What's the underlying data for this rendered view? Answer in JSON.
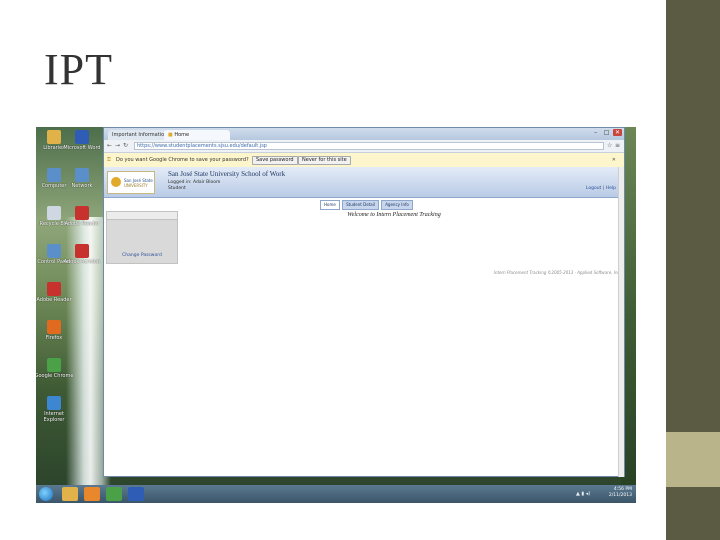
{
  "slide": {
    "title": "IPT"
  },
  "desktop": {
    "icons": [
      {
        "label": "Libraries",
        "icon": "folder-icon",
        "color": "#e2b24a"
      },
      {
        "label": "Microsoft Word",
        "icon": "word-icon",
        "color": "#2f5db5"
      },
      {
        "label": "Computer",
        "icon": "computer-icon",
        "color": "#5b8fc9"
      },
      {
        "label": "Network",
        "icon": "network-icon",
        "color": "#5b8fc9"
      },
      {
        "label": "Recycle Bin",
        "icon": "recycle-bin-icon",
        "color": "#cfd8e2"
      },
      {
        "label": "Adobe Reader",
        "icon": "pdf-icon",
        "color": "#c7322f"
      },
      {
        "label": "Control Panel",
        "icon": "control-panel-icon",
        "color": "#5b8fc9"
      },
      {
        "label": "Adobe Acrobat",
        "icon": "pdf-icon",
        "color": "#c7322f"
      },
      {
        "label": "Adobe Reader",
        "icon": "pdf-icon",
        "color": "#c7322f"
      },
      {
        "label": "Firefox",
        "icon": "firefox-icon",
        "color": "#e06a1f"
      },
      {
        "label": "Google Chrome",
        "icon": "chrome-icon",
        "color": "#4aa148"
      },
      {
        "label": "Internet Explorer",
        "icon": "ie-icon",
        "color": "#3d86d1"
      }
    ]
  },
  "browser": {
    "tabs": [
      {
        "label": "Important Informatio",
        "active": false
      },
      {
        "label": "Home",
        "active": true
      }
    ],
    "window_buttons": {
      "minimize": "–",
      "maximize": "□",
      "close": "✕"
    },
    "nav": {
      "back": "←",
      "forward": "→",
      "reload": "↻",
      "star": "☆",
      "wrench": "≡"
    },
    "url": "https://www.studentplacements.sjsu.edu/default.jsp",
    "infobar": {
      "question": "Do you want Google Chrome to save your password?",
      "save_label": "Save password",
      "never_label": "Never for this site",
      "close": "✕"
    }
  },
  "site": {
    "logo_line1": "San José State",
    "logo_line2": "UNIVERSITY",
    "title": "San José State University School of Work",
    "logged_in": "Logged in: Adair Bloom",
    "role": "Student",
    "logout": "Logout",
    "help": "Help",
    "separator": "|",
    "tabs": [
      {
        "label": "Home",
        "active": true
      },
      {
        "label": "Student Detail",
        "active": false
      },
      {
        "label": "Agency Info",
        "active": false
      }
    ],
    "sidebar_link": "Change Password",
    "welcome": "Welcome to Intern Placement Tracking",
    "footer": "Intern Placement Tracking ©2005-2013 · Applied Software, Inc."
  },
  "taskbar": {
    "apps": [
      {
        "name": "windows-explorer",
        "icon": "folder-icon",
        "color": "#e2b24a"
      },
      {
        "name": "media-player",
        "icon": "media-icon",
        "color": "#e8872b"
      },
      {
        "name": "chrome",
        "icon": "chrome-icon",
        "color": "#4aa148"
      },
      {
        "name": "word",
        "icon": "word-icon",
        "color": "#2f5db5"
      }
    ],
    "tray": "▲ ▮ ◂)",
    "time": "4:56 PM",
    "date": "2/11/2013"
  }
}
